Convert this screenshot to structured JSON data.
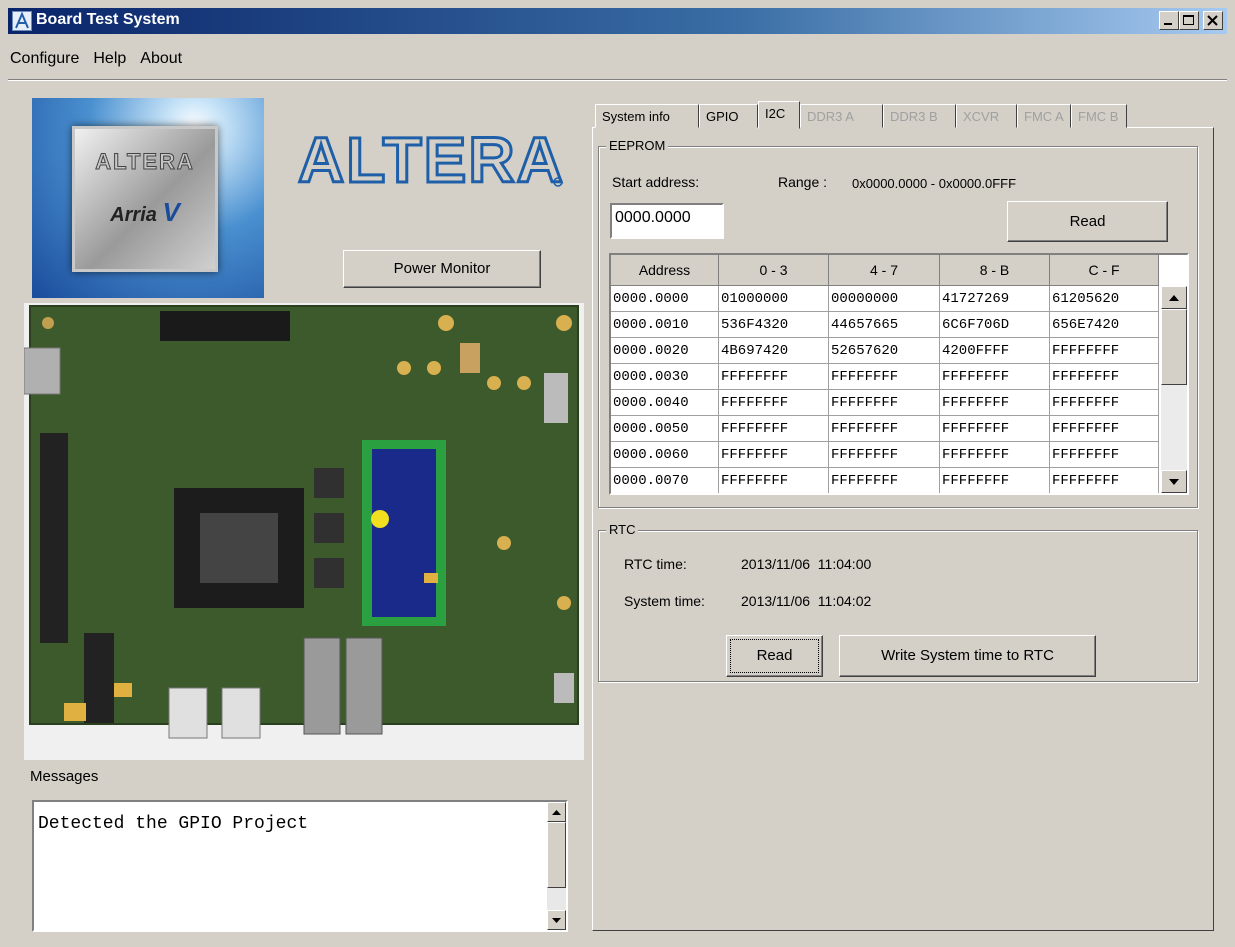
{
  "window": {
    "title": "Board Test System",
    "app_icon": "altera-a-icon",
    "controls": [
      "minimize-icon",
      "maximize-icon",
      "close-icon"
    ]
  },
  "menu": {
    "items": [
      "Configure",
      "Help",
      "About"
    ]
  },
  "left": {
    "chip_logo": {
      "brand": "ALTERA",
      "model": "Arria",
      "model_suffix": "V"
    },
    "altera_logo": "ALTERA",
    "power_monitor_label": "Power Monitor",
    "messages_label": "Messages",
    "messages": [
      "Detected the GPIO Project"
    ]
  },
  "tabs": [
    {
      "label": "System info",
      "state": "enabled"
    },
    {
      "label": "GPIO",
      "state": "enabled"
    },
    {
      "label": "I2C",
      "state": "active"
    },
    {
      "label": "DDR3 A",
      "state": "disabled"
    },
    {
      "label": "DDR3 B",
      "state": "disabled"
    },
    {
      "label": "XCVR",
      "state": "disabled"
    },
    {
      "label": "FMC A",
      "state": "disabled"
    },
    {
      "label": "FMC B",
      "state": "disabled"
    }
  ],
  "eeprom": {
    "group_title": "EEPROM",
    "start_address_label": "Start address:",
    "range_label": "Range :",
    "range_value": "0x0000.0000 - 0x0000.0FFF",
    "start_address_value": "0000.0000",
    "read_label": "Read",
    "columns": [
      "Address",
      "0 - 3",
      "4 - 7",
      "8 - B",
      "C - F"
    ],
    "rows": [
      [
        "0000.0000",
        "01000000",
        "00000000",
        "41727269",
        "61205620"
      ],
      [
        "0000.0010",
        "536F4320",
        "44657665",
        "6C6F706D",
        "656E7420"
      ],
      [
        "0000.0020",
        "4B697420",
        "52657620",
        "4200FFFF",
        "FFFFFFFF"
      ],
      [
        "0000.0030",
        "FFFFFFFF",
        "FFFFFFFF",
        "FFFFFFFF",
        "FFFFFFFF"
      ],
      [
        "0000.0040",
        "FFFFFFFF",
        "FFFFFFFF",
        "FFFFFFFF",
        "FFFFFFFF"
      ],
      [
        "0000.0050",
        "FFFFFFFF",
        "FFFFFFFF",
        "FFFFFFFF",
        "FFFFFFFF"
      ],
      [
        "0000.0060",
        "FFFFFFFF",
        "FFFFFFFF",
        "FFFFFFFF",
        "FFFFFFFF"
      ],
      [
        "0000.0070",
        "FFFFFFFF",
        "FFFFFFFF",
        "FFFFFFFF",
        "FFFFFFFF"
      ]
    ]
  },
  "rtc": {
    "group_title": "RTC",
    "rtc_time_label": "RTC time:",
    "rtc_time_value": "2013/11/06  11:04:00",
    "system_time_label": "System time:",
    "system_time_value": "2013/11/06  11:04:02",
    "read_label": "Read",
    "write_label": "Write System time to RTC"
  },
  "colors": {
    "window_bg": "#d4d0c8",
    "titlebar_start": "#0a246a",
    "titlebar_end": "#a6caf0",
    "altera_blue": "#1f5fa8",
    "board_pcb": "#3d5a2c",
    "lcd_blue": "#1a2a8a"
  }
}
